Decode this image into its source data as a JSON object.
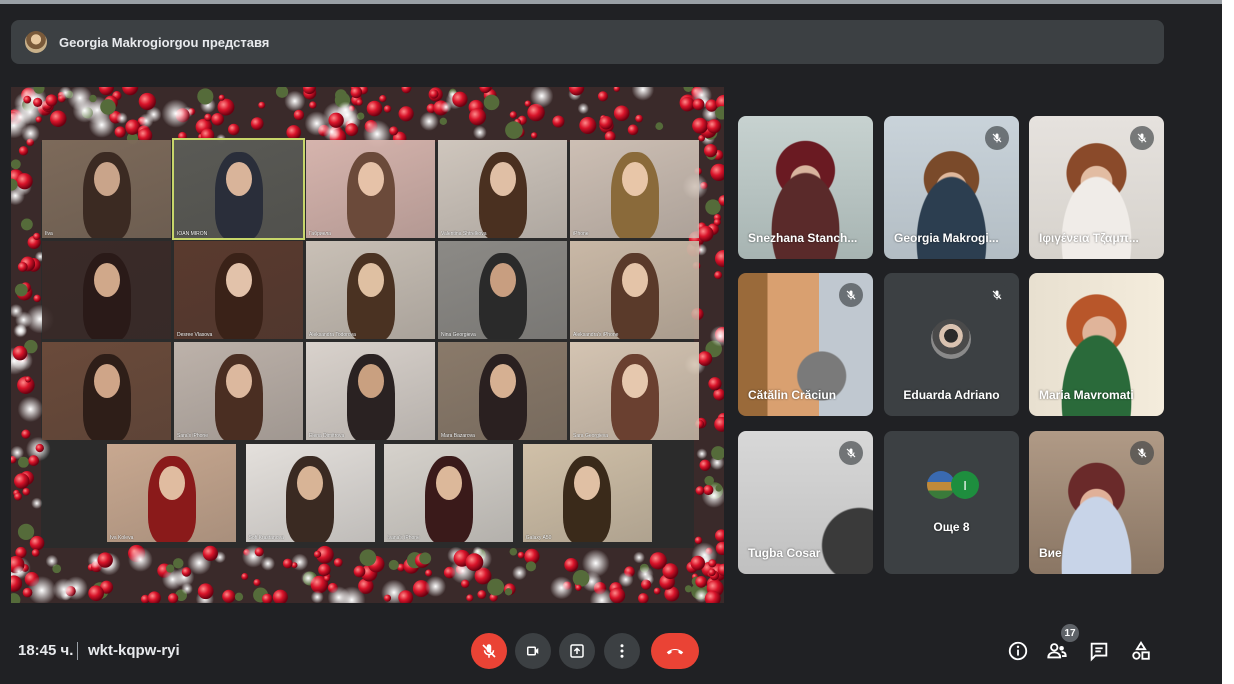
{
  "presenter_banner": {
    "text": "Georgia Makrogiorgou представя"
  },
  "presentation": {
    "tiles": [
      {
        "caption": "Ilva"
      },
      {
        "caption": "IOAN MIRON"
      },
      {
        "caption": "Габриела"
      },
      {
        "caption": "Valentina Shtrelkova"
      },
      {
        "caption": "iPhone"
      },
      {
        "caption": ""
      },
      {
        "caption": "Desree Vlasova"
      },
      {
        "caption": "Aleksandra Todorova"
      },
      {
        "caption": "Nina Georgieva"
      },
      {
        "caption": "Aleksandra's iPhone"
      },
      {
        "caption": ""
      },
      {
        "caption": "Sara's iPhone"
      },
      {
        "caption": "Elena Dimitrova"
      },
      {
        "caption": "Mara Bazarova"
      },
      {
        "caption": "Sara Georgieva"
      },
      {
        "caption": "Iva Koleva"
      },
      {
        "caption": "Sofi Krastanova"
      },
      {
        "caption": "Ivana's iPhone"
      },
      {
        "caption": "Galaxy A50"
      }
    ]
  },
  "participants": [
    {
      "name": "Snezhana Stanch...",
      "muted": false
    },
    {
      "name": "Georgia Makrogi...",
      "muted": true
    },
    {
      "name": "Ιφιγένεια Τζαμπ...",
      "muted": true
    },
    {
      "name": "Cătălin Crăciun",
      "muted": true
    },
    {
      "name": "Eduarda Adriano",
      "muted": true
    },
    {
      "name": "Maria Mavromati",
      "muted": false
    },
    {
      "name": "Tugba Cosar",
      "muted": true
    },
    {
      "name": "Още 8",
      "muted": false,
      "avatar_letter": "I"
    },
    {
      "name": "Вие",
      "muted": true
    }
  ],
  "bottom_bar": {
    "time": "18:45 ч.",
    "meeting_code": "wkt-kqpw-ryi",
    "participant_count": "17"
  },
  "icons": {
    "mic": "mic-off-icon",
    "camera": "videocam-icon",
    "present": "present-screen-icon",
    "more": "more-vert-icon",
    "leave": "call-end-icon",
    "info": "info-icon",
    "people": "people-icon",
    "chat": "chat-icon",
    "activities": "activities-icon"
  },
  "colors": {
    "background": "#202124",
    "tile": "#3c4043",
    "red": "#ea4335",
    "avatar_green": "#1e8e3e"
  }
}
